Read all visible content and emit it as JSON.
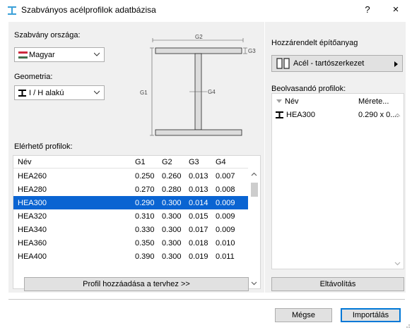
{
  "window": {
    "title": "Szabványos acélprofilok adatbázisa",
    "help": "?",
    "close": "×"
  },
  "left": {
    "standard_label": "Szabvány országa:",
    "standard_value": "Magyar",
    "geometry_label": "Geometria:",
    "geometry_value": "I / H alakú",
    "available_label": "Elérhető profilok:",
    "diagram": {
      "g1": "G1",
      "g2": "G2",
      "g3": "G3",
      "g4": "G4"
    },
    "table": {
      "columns": [
        "Név",
        "G1",
        "G2",
        "G3",
        "G4"
      ],
      "rows": [
        [
          "HEA260",
          "0.250",
          "0.260",
          "0.013",
          "0.007"
        ],
        [
          "HEA280",
          "0.270",
          "0.280",
          "0.013",
          "0.008"
        ],
        [
          "HEA300",
          "0.290",
          "0.300",
          "0.014",
          "0.009"
        ],
        [
          "HEA320",
          "0.310",
          "0.300",
          "0.015",
          "0.009"
        ],
        [
          "HEA340",
          "0.330",
          "0.300",
          "0.017",
          "0.009"
        ],
        [
          "HEA360",
          "0.350",
          "0.300",
          "0.018",
          "0.010"
        ],
        [
          "HEA400",
          "0.390",
          "0.300",
          "0.019",
          "0.011"
        ]
      ],
      "selected_index": 2
    },
    "add_button": "Profil hozzáadása a tervhez >>"
  },
  "right": {
    "material_label": "Hozzárendelt építőanyag",
    "material_value": "Acél - tartószerkezet",
    "load_label": "Beolvasandó profilok:",
    "load_columns": [
      "Név",
      "Mérete..."
    ],
    "load_rows": [
      [
        "HEA300",
        "0.290 x 0...."
      ]
    ],
    "remove_button": "Eltávolítás"
  },
  "footer": {
    "cancel": "Mégse",
    "import": "Importálás"
  },
  "colors": {
    "selection": "#0a64d2",
    "flag_red": "#cd2a3e",
    "flag_white": "#ffffff",
    "flag_green": "#436f4d",
    "title_icon": "#3aa0d8"
  }
}
